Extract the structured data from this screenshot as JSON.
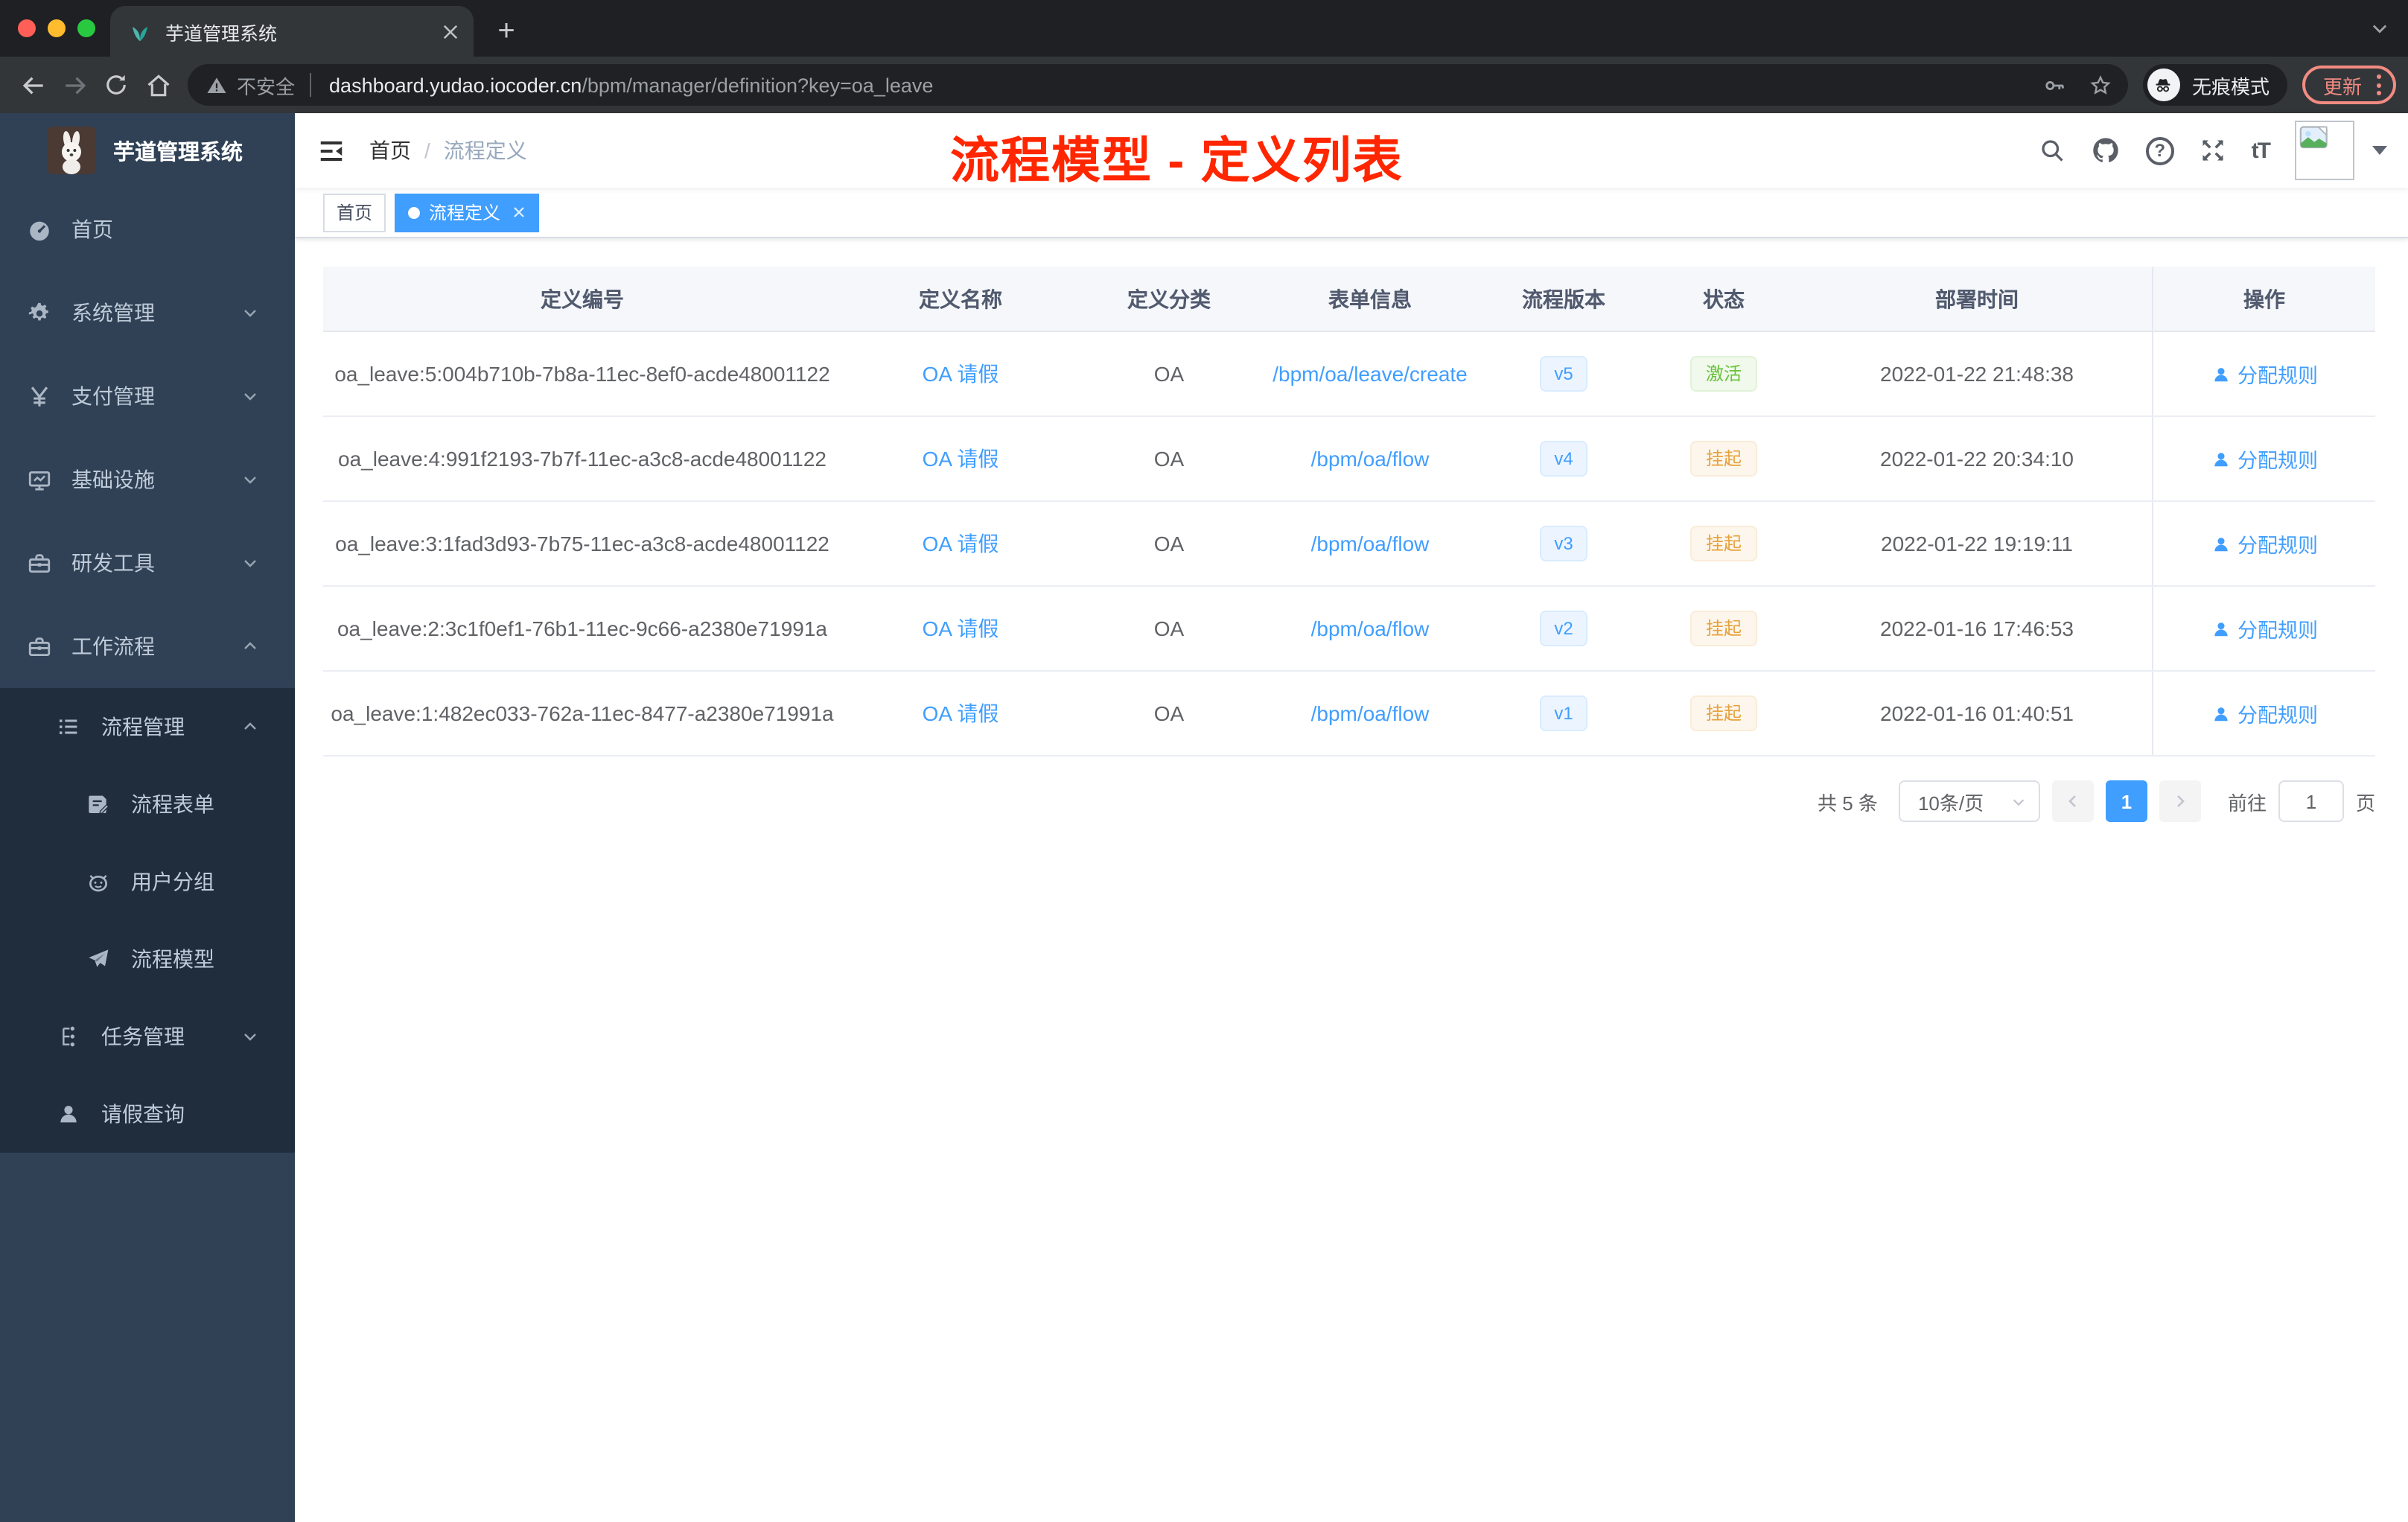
{
  "colors": {
    "primary": "#409eff",
    "annotation_red": "#ff2600",
    "status_active_green": "#67c23a",
    "status_suspend_orange": "#e6a23c",
    "sidebar_bg": "#304156",
    "submenu_bg": "#1f2d3d"
  },
  "browser": {
    "tab_title": "芋道管理系统",
    "security_label": "不安全",
    "url_domain": "dashboard.yudao.iocoder.cn",
    "url_path": "/bpm/manager/definition?key=oa_leave",
    "incognito_label": "无痕模式",
    "update_label": "更新"
  },
  "icons": {
    "plus": "+",
    "help": "?",
    "font_size": "tT"
  },
  "sidebar": {
    "title": "芋道管理系统",
    "items": [
      {
        "label": "首页"
      },
      {
        "label": "系统管理"
      },
      {
        "label": "支付管理"
      },
      {
        "label": "基础设施"
      },
      {
        "label": "研发工具"
      },
      {
        "label": "工作流程"
      },
      {
        "label": "流程管理"
      },
      {
        "label": "流程表单"
      },
      {
        "label": "用户分组"
      },
      {
        "label": "流程模型"
      },
      {
        "label": "任务管理"
      },
      {
        "label": "请假查询"
      }
    ]
  },
  "header": {
    "breadcrumb_home": "首页",
    "breadcrumb_sep": "/",
    "breadcrumb_current": "流程定义",
    "annotation": "流程模型 - 定义列表"
  },
  "tags": {
    "home": "首页",
    "active": "流程定义"
  },
  "table": {
    "columns": [
      "定义编号",
      "定义名称",
      "定义分类",
      "表单信息",
      "流程版本",
      "状态",
      "部署时间",
      "操作"
    ],
    "rows": [
      {
        "id": "oa_leave:5:004b710b-7b8a-11ec-8ef0-acde48001122",
        "name": "OA 请假",
        "category": "OA",
        "form": "/bpm/oa/leave/create",
        "version": "v5",
        "status": "激活",
        "time": "2022-01-22 21:48:38",
        "action": "分配规则"
      },
      {
        "id": "oa_leave:4:991f2193-7b7f-11ec-a3c8-acde48001122",
        "name": "OA 请假",
        "category": "OA",
        "form": "/bpm/oa/flow",
        "version": "v4",
        "status": "挂起",
        "time": "2022-01-22 20:34:10",
        "action": "分配规则"
      },
      {
        "id": "oa_leave:3:1fad3d93-7b75-11ec-a3c8-acde48001122",
        "name": "OA 请假",
        "category": "OA",
        "form": "/bpm/oa/flow",
        "version": "v3",
        "status": "挂起",
        "time": "2022-01-22 19:19:11",
        "action": "分配规则"
      },
      {
        "id": "oa_leave:2:3c1f0ef1-76b1-11ec-9c66-a2380e71991a",
        "name": "OA 请假",
        "category": "OA",
        "form": "/bpm/oa/flow",
        "version": "v2",
        "status": "挂起",
        "time": "2022-01-16 17:46:53",
        "action": "分配规则"
      },
      {
        "id": "oa_leave:1:482ec033-762a-11ec-8477-a2380e71991a",
        "name": "OA 请假",
        "category": "OA",
        "form": "/bpm/oa/flow",
        "version": "v1",
        "status": "挂起",
        "time": "2022-01-16 01:40:51",
        "action": "分配规则"
      }
    ]
  },
  "pagination": {
    "total": "共 5 条",
    "page_size": "10条/页",
    "page": "1",
    "goto_label": "前往",
    "goto_value": "1",
    "page_unit": "页"
  }
}
